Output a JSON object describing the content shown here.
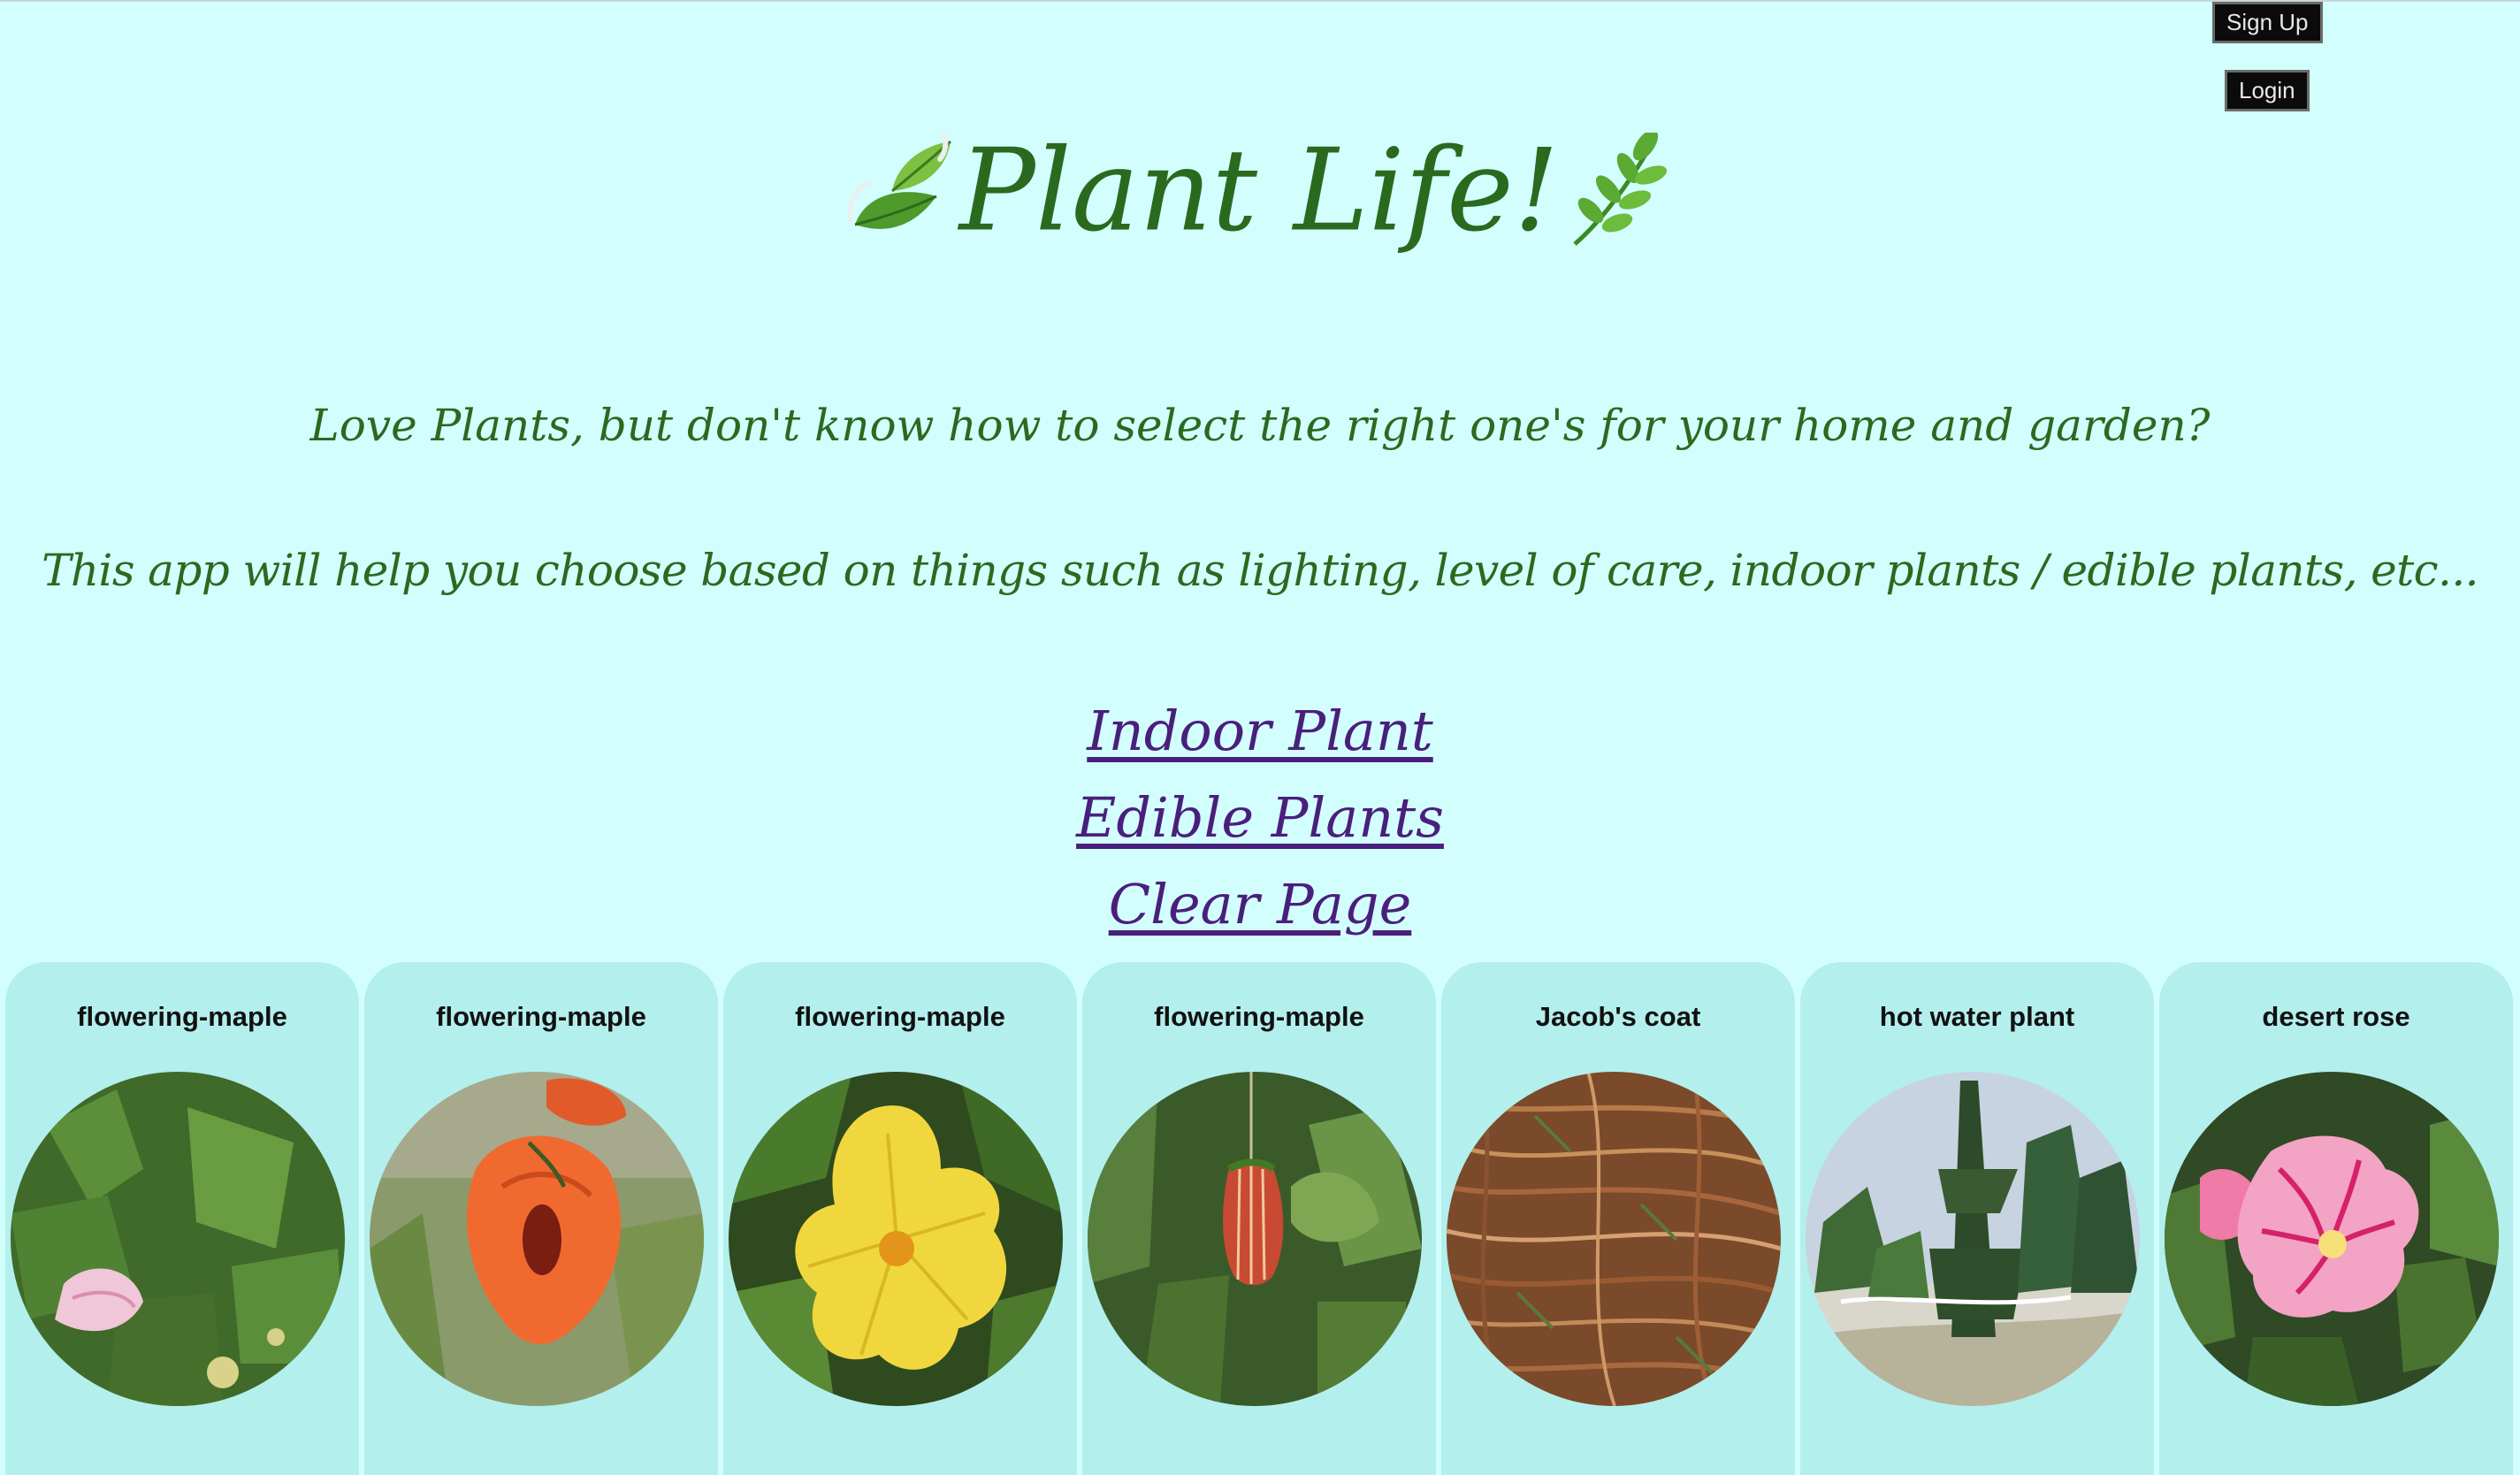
{
  "auth": {
    "signup_label": "Sign Up",
    "login_label": "Login"
  },
  "header": {
    "title": "Plant Life!",
    "left_icon": "leaves-icon",
    "right_icon": "herb-icon"
  },
  "intro": {
    "line1": "Love Plants, but don't know how to select the right one's for your home and garden?",
    "line2": "This app will help you choose based on things such as lighting, level of care, indoor plants / edible plants, etc..."
  },
  "nav": {
    "indoor": "Indoor Plant",
    "edible": "Edible Plants",
    "clear": "Clear Page"
  },
  "colors": {
    "background": "#d2fffe",
    "card": "#b3efec",
    "heading_green": "#2a6a1f",
    "link_purple": "#4a1f7c"
  },
  "plants": [
    {
      "name": "flowering-maple",
      "image": "pink-bell-flower"
    },
    {
      "name": "flowering-maple",
      "image": "orange-flower"
    },
    {
      "name": "flowering-maple",
      "image": "yellow-flower"
    },
    {
      "name": "flowering-maple",
      "image": "red-veined-bell-flower"
    },
    {
      "name": "Jacob's coat",
      "image": "copper-foliage"
    },
    {
      "name": "hot water plant",
      "image": "conifer-garden"
    },
    {
      "name": "desert rose",
      "image": "pink-striped-flower"
    }
  ]
}
